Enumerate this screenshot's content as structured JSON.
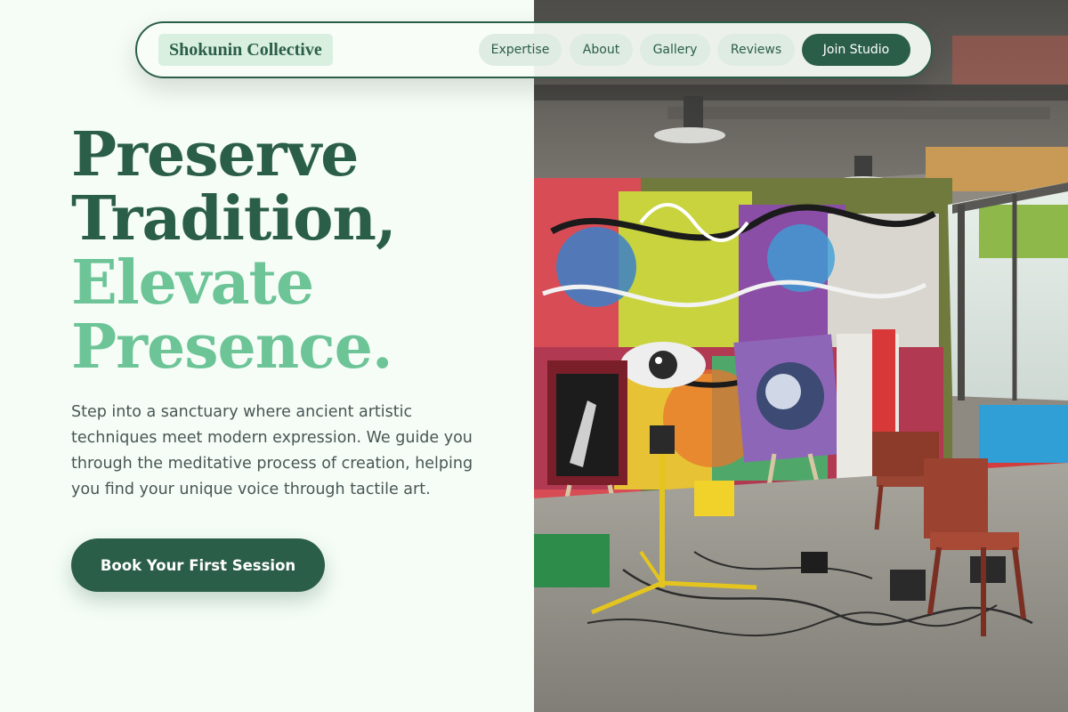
{
  "nav": {
    "brand": "Shokunin Collective",
    "links": [
      "Expertise",
      "About",
      "Gallery",
      "Reviews"
    ],
    "cta": "Join Studio"
  },
  "hero": {
    "headline_lines": [
      "Preserve",
      "Tradition,",
      "Elevate",
      "Presence."
    ],
    "description": "Step into a sanctuary where ancient artistic techniques meet modern expression. We guide you through the meditative process of creation, helping you find your unique voice through tactile art.",
    "cta": "Book Your First Session"
  },
  "colors": {
    "brand_dark": "#2b5e48",
    "brand_light": "#6cc497",
    "background": "#f5fdf6",
    "body_text": "#4a5655"
  }
}
